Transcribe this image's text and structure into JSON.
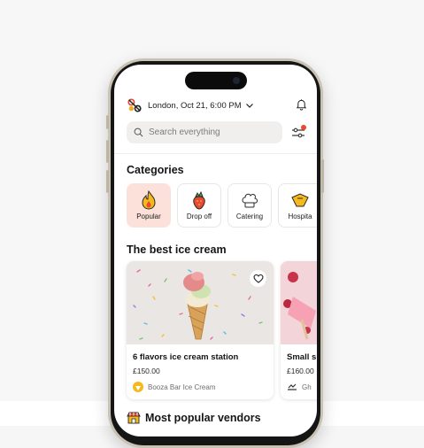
{
  "header": {
    "location_text": "London, Oct 21, 6:00 PM",
    "logo_icon": "app-logo-icon",
    "dropdown_icon": "chevron-down-icon",
    "notification_icon": "bell-icon"
  },
  "search": {
    "placeholder": "Search everything",
    "icon": "search-icon",
    "filter_icon": "filter-icon",
    "filter_badge_color": "#e8492f"
  },
  "categories": {
    "title": "Categories",
    "items": [
      {
        "label": "Popular",
        "icon": "fire-icon",
        "active": true
      },
      {
        "label": "Drop off",
        "icon": "strawberry-icon",
        "active": false
      },
      {
        "label": "Catering",
        "icon": "chef-hat-icon",
        "active": false
      },
      {
        "label": "Hospita",
        "icon": "hospitality-icon",
        "active": false
      }
    ]
  },
  "best_ice_cream": {
    "title": "The best ice cream",
    "cards": [
      {
        "name": "6 flavors ice cream station",
        "price": "£150.00",
        "vendor": "Booza Bar Ice Cream",
        "favorite_icon": "heart-icon"
      },
      {
        "name": "Small s",
        "price": "£160.00",
        "vendor": "Gh"
      }
    ]
  },
  "most_popular": {
    "title": "Most popular vendors",
    "icon": "store-icon"
  },
  "colors": {
    "accent": "#e8492f",
    "active_category_bg": "#fbe1d9"
  }
}
